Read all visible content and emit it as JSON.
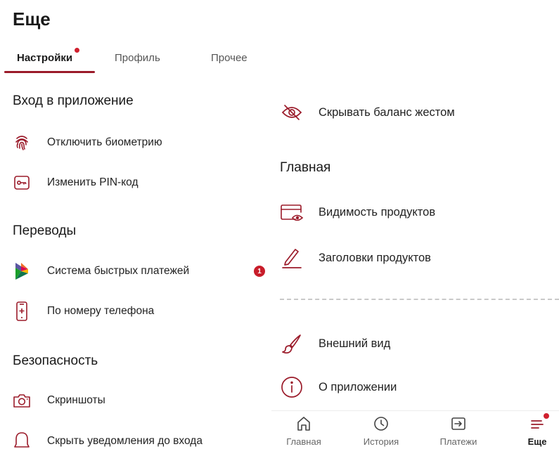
{
  "page_title": "Еще",
  "tabs": [
    {
      "label": "Настройки",
      "active": true
    },
    {
      "label": "Профиль",
      "active": false
    },
    {
      "label": "Прочее",
      "active": false
    }
  ],
  "left": {
    "login_section": {
      "title": "Вход в приложение",
      "items": [
        {
          "label": "Отключить биометрию",
          "icon": "fingerprint-icon"
        },
        {
          "label": "Изменить PIN-код",
          "icon": "key-icon"
        }
      ]
    },
    "transfers_section": {
      "title": "Переводы",
      "items": [
        {
          "label": "Система быстрых платежей",
          "icon": "sbp-logo-icon",
          "badge": "1"
        },
        {
          "label": "По номеру телефона",
          "icon": "phone-plus-icon"
        }
      ]
    },
    "security_section": {
      "title": "Безопасность",
      "items": [
        {
          "label": "Скриншоты",
          "icon": "camera-icon"
        },
        {
          "label": "Скрыть уведомления до входа",
          "icon": "bell-icon"
        }
      ]
    }
  },
  "right": {
    "hide_balance": {
      "label": "Скрывать баланс жестом",
      "icon": "eye-off-icon"
    },
    "main_section": {
      "title": "Главная",
      "items": [
        {
          "label": "Видимость продуктов",
          "icon": "card-eye-icon"
        },
        {
          "label": "Заголовки продуктов",
          "icon": "pencil-icon"
        }
      ]
    },
    "other_items": [
      {
        "label": "Внешний вид",
        "icon": "brush-icon"
      },
      {
        "label": "О приложении",
        "icon": "info-icon"
      }
    ]
  },
  "bottom_nav": [
    {
      "label": "Главная",
      "icon": "home-icon",
      "active": false
    },
    {
      "label": "История",
      "icon": "clock-icon",
      "active": false
    },
    {
      "label": "Платежи",
      "icon": "payments-icon",
      "active": false
    },
    {
      "label": "Еще",
      "icon": "menu-icon",
      "active": true
    }
  ],
  "colors": {
    "accent": "#9b1b2a",
    "badge": "#c81d2a",
    "text": "#1a1a1a"
  }
}
